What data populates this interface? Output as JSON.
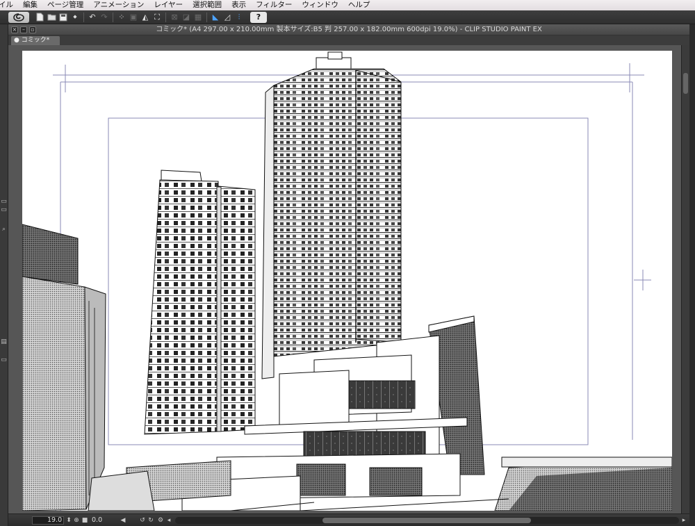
{
  "menu": {
    "items": [
      "イル",
      "編集",
      "ページ管理",
      "アニメーション",
      "レイヤー",
      "選択範囲",
      "表示",
      "フィルター",
      "ウィンドウ",
      "ヘルプ"
    ]
  },
  "toolbar": {
    "icons": [
      "clip-studio-logo-icon",
      "new-file-icon",
      "open-folder-icon",
      "save-icon",
      "undo-icon",
      "redo-icon",
      "transform-icon",
      "fill-icon",
      "erase-icon",
      "ruler-icon",
      "help-icon"
    ]
  },
  "document": {
    "title": "コミック* (A4 297.00 x 210.00mm 製本サイズ:B5 判 257.00 x 182.00mm 600dpi 19.0%)  - CLIP STUDIO PAINT EX",
    "tab_label": "コミック*"
  },
  "status": {
    "zoom": "19.0",
    "rotation": "0.0"
  },
  "colors": {
    "menubar": "#e8e3e6",
    "toolbar": "#363636",
    "canvas_bg": "#565656",
    "paper": "#ffffff",
    "frame_line": "#8a8ab5"
  }
}
